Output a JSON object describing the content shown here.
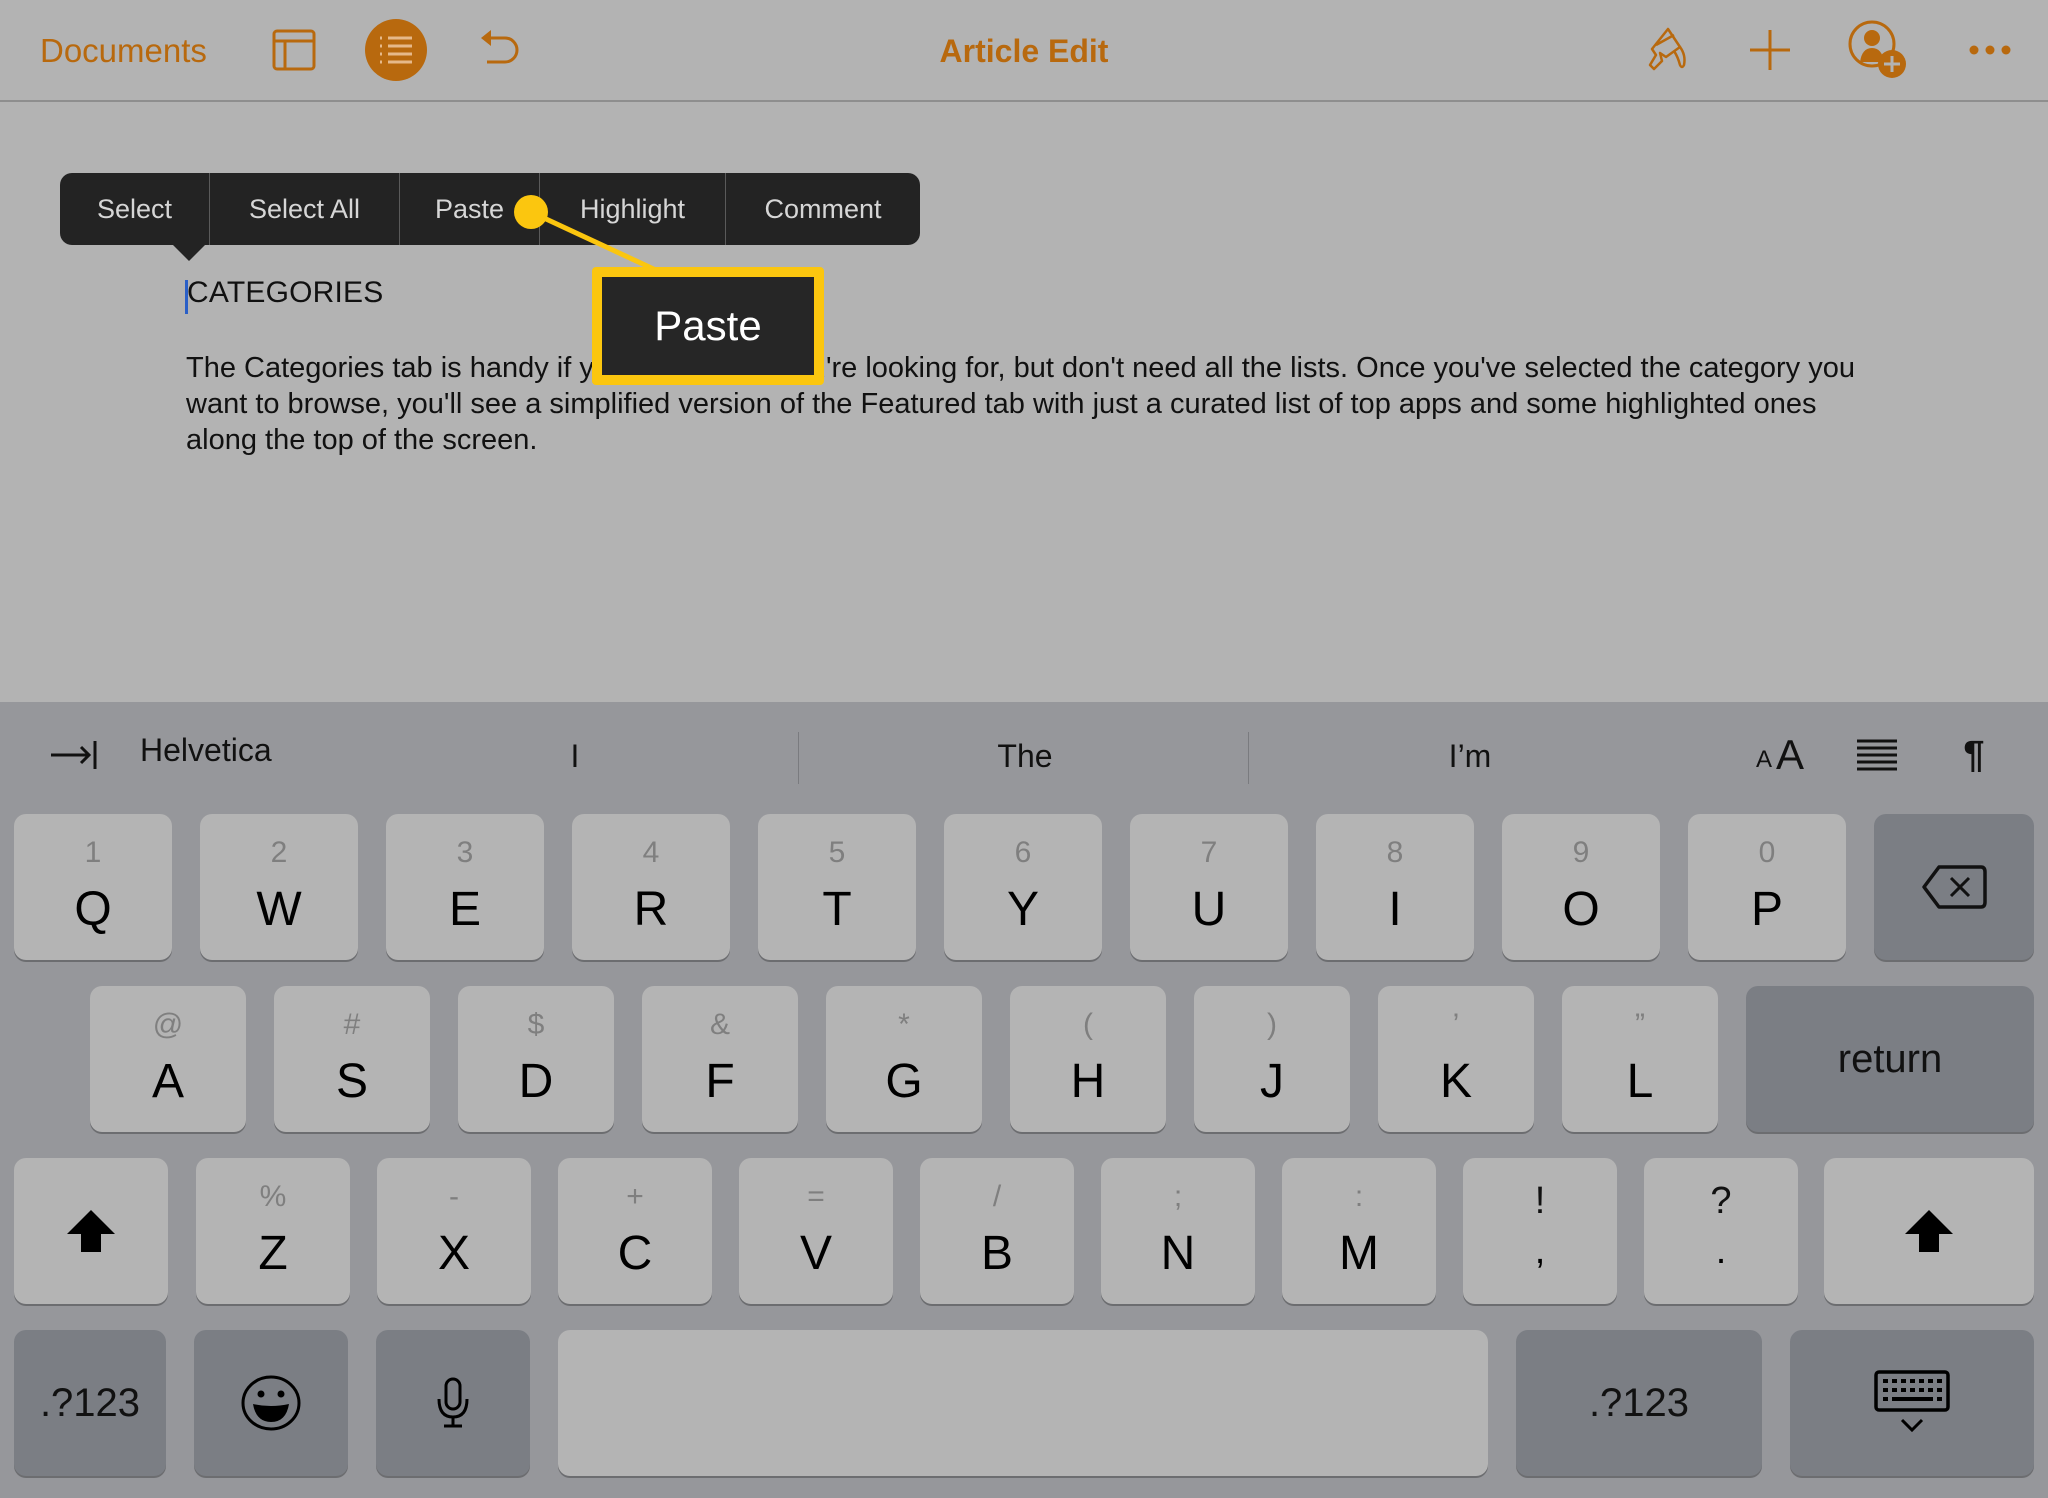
{
  "navbar": {
    "back_label": "Documents",
    "title": "Article Edit",
    "accent_color": "#b8690e",
    "left_icons": [
      "sidebar-icon",
      "list-view-icon",
      "undo-icon"
    ],
    "right_icons": [
      "paintbrush-icon",
      "plus-icon",
      "add-person-icon",
      "more-icon"
    ]
  },
  "edit_menu": {
    "items": [
      "Select",
      "Select All",
      "Paste",
      "Highlight",
      "Comment"
    ]
  },
  "callout": {
    "label": "Paste",
    "color": "#fbc60f"
  },
  "document": {
    "heading": "CATEGORIES",
    "body": "The Categories tab is handy if you know what you're looking for, but don't need all the lists. Once you've selected the category you want to browse, you'll see a simplified version of the Featured tab with just a curated list of top apps and some highlighted ones along the top of the screen."
  },
  "shortcut_bar": {
    "tab_icon": "tab-icon",
    "font_name": "Helvetica",
    "suggestions": [
      "I",
      "The",
      "I’m"
    ],
    "format_icons": [
      "font-size-icon",
      "align-icon",
      "paragraph-icon"
    ],
    "font_size_small": "A",
    "font_size_large": "A"
  },
  "keyboard": {
    "row1": [
      {
        "main": "Q",
        "alt": "1"
      },
      {
        "main": "W",
        "alt": "2"
      },
      {
        "main": "E",
        "alt": "3"
      },
      {
        "main": "R",
        "alt": "4"
      },
      {
        "main": "T",
        "alt": "5"
      },
      {
        "main": "Y",
        "alt": "6"
      },
      {
        "main": "U",
        "alt": "7"
      },
      {
        "main": "I",
        "alt": "8"
      },
      {
        "main": "O",
        "alt": "9"
      },
      {
        "main": "P",
        "alt": "0"
      }
    ],
    "row2": [
      {
        "main": "A",
        "alt": "@"
      },
      {
        "main": "S",
        "alt": "#"
      },
      {
        "main": "D",
        "alt": "$"
      },
      {
        "main": "F",
        "alt": "&"
      },
      {
        "main": "G",
        "alt": "*"
      },
      {
        "main": "H",
        "alt": "("
      },
      {
        "main": "J",
        "alt": ")"
      },
      {
        "main": "K",
        "alt": "’"
      },
      {
        "main": "L",
        "alt": "”"
      }
    ],
    "row3": [
      {
        "main": "Z",
        "alt": "%"
      },
      {
        "main": "X",
        "alt": "-"
      },
      {
        "main": "C",
        "alt": "+"
      },
      {
        "main": "V",
        "alt": "="
      },
      {
        "main": "B",
        "alt": "/"
      },
      {
        "main": "N",
        "alt": ";"
      },
      {
        "main": "M",
        "alt": ":"
      },
      {
        "main": ",",
        "alt": "!"
      },
      {
        "main": ".",
        "alt": "?"
      }
    ],
    "return_label": "return",
    "numbers_label": ".?123",
    "space_label": ""
  }
}
